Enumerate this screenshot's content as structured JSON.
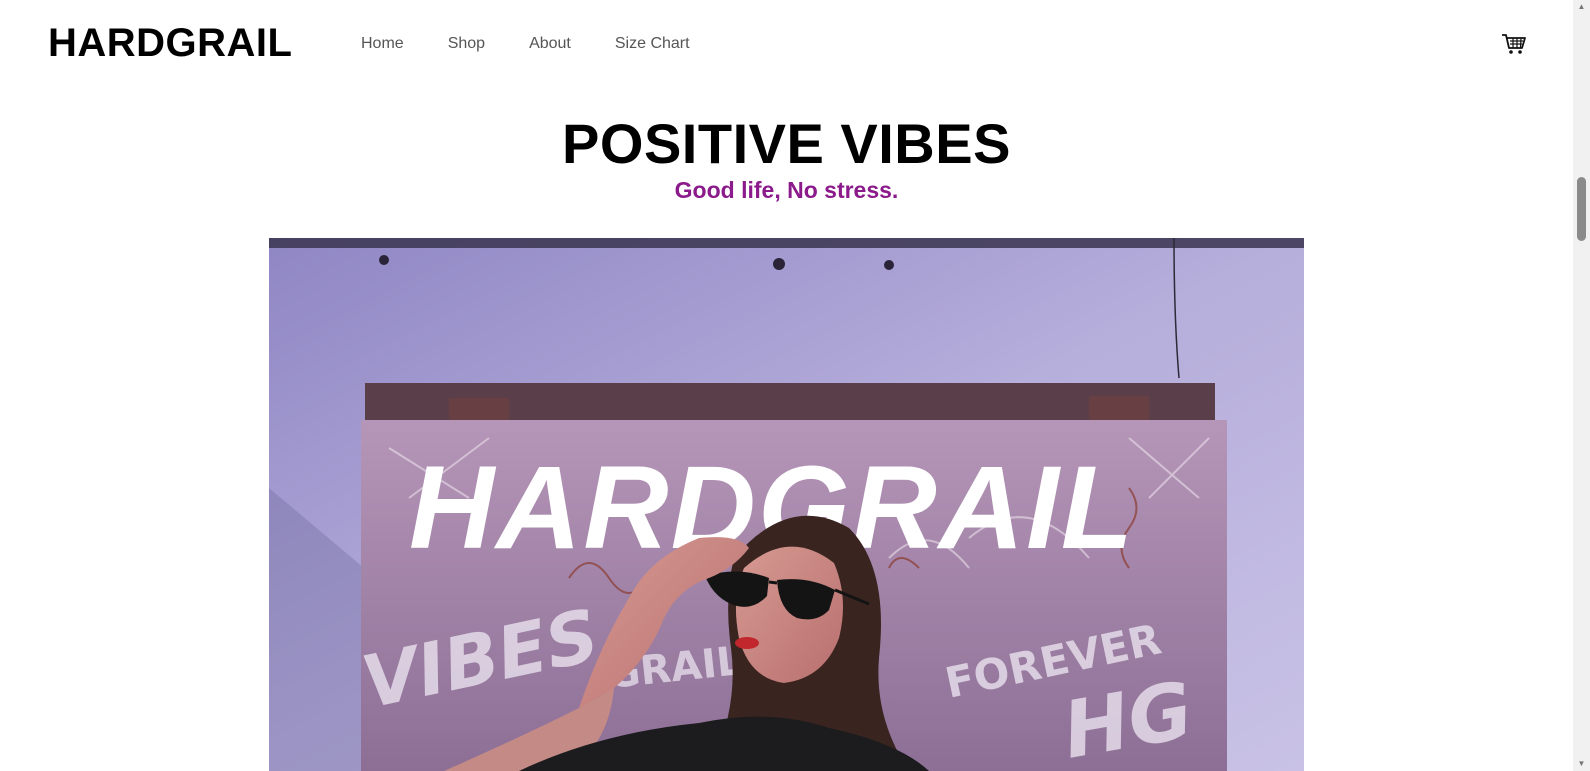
{
  "header": {
    "brand": "HARDGRAIL",
    "nav": [
      {
        "label": "Home"
      },
      {
        "label": "Shop"
      },
      {
        "label": "About"
      },
      {
        "label": "Size Chart"
      }
    ],
    "cart_icon": "cart-icon"
  },
  "hero": {
    "title": "POSITIVE VIBES",
    "subtitle": "Good life, No stress.",
    "subtitle_color": "#8b1a8b"
  },
  "banner": {
    "image_text": "HARDGRAIL",
    "graffiti": [
      "VIBES",
      "GRAIL",
      "FOREVER",
      "HG"
    ]
  },
  "scrollbar": {
    "up_icon": "scroll-up-arrow-icon",
    "down_icon": "scroll-down-arrow-icon"
  }
}
